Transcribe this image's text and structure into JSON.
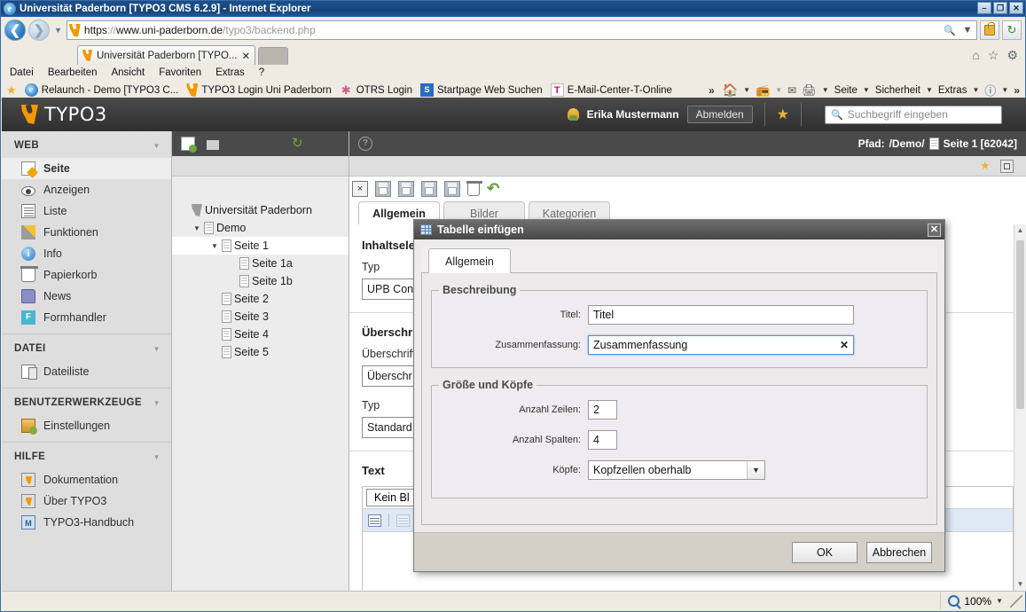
{
  "browser": {
    "window_title": "Universität Paderborn [TYPO3 CMS 6.2.9] - Internet Explorer",
    "minimize_label": "–",
    "maximize_label": "❐",
    "close_label": "✕",
    "url_scheme": "https",
    "url_sep": "://",
    "url_host": "www.uni-paderborn.de",
    "url_path": "/typo3/backend.php",
    "url_full": "https://www.uni-paderborn.de/typo3/backend.php",
    "tab_title": "Universität Paderborn [TYPO...",
    "tab_close": "✕",
    "menu": [
      "Datei",
      "Bearbeiten",
      "Ansicht",
      "Favoriten",
      "Extras",
      "?"
    ],
    "links": [
      {
        "label": "Relaunch - Demo [TYPO3 C...",
        "icon": "ie-icon"
      },
      {
        "label": "TYPO3 Login Uni Paderborn",
        "icon": "typo3-icon"
      },
      {
        "label": "OTRS Login",
        "icon": "otrs-icon"
      },
      {
        "label": "Startpage Web Suchen",
        "icon": "startpage-icon"
      },
      {
        "label": "E-Mail-Center-T-Online",
        "icon": "telekom-icon"
      }
    ],
    "command_bar": [
      "Seite",
      "Sicherheit",
      "Extras"
    ],
    "overflow": "»",
    "zoom_level": "100%"
  },
  "typo3": {
    "brand": "TYPO3",
    "user_name": "Erika Mustermann",
    "logout_label": "Abmelden",
    "search_placeholder": "Suchbegriff eingeben",
    "path_label": "Pfad:",
    "path_value": "/Demo/",
    "path_page": "Seite 1 [62042]",
    "modules": [
      {
        "group": "WEB",
        "items": [
          {
            "label": "Seite",
            "icon": "page-icon",
            "active": true
          },
          {
            "label": "Anzeigen",
            "icon": "eye-icon",
            "active": false
          },
          {
            "label": "Liste",
            "icon": "list-icon",
            "active": false
          },
          {
            "label": "Funktionen",
            "icon": "wand-icon",
            "active": false
          },
          {
            "label": "Info",
            "icon": "info-icon",
            "active": false
          },
          {
            "label": "Papierkorb",
            "icon": "trash-icon",
            "active": false
          },
          {
            "label": "News",
            "icon": "folder-icon",
            "active": false
          },
          {
            "label": "Formhandler",
            "icon": "form-icon",
            "active": false
          }
        ]
      },
      {
        "group": "DATEI",
        "items": [
          {
            "label": "Dateiliste",
            "icon": "filelist-icon",
            "active": false
          }
        ]
      },
      {
        "group": "BENUTZERWERKZEUGE",
        "items": [
          {
            "label": "Einstellungen",
            "icon": "settings-icon",
            "active": false
          }
        ]
      },
      {
        "group": "HILFE",
        "items": [
          {
            "label": "Dokumentation",
            "icon": "doc-icon",
            "active": false
          },
          {
            "label": "Über TYPO3",
            "icon": "doc-icon",
            "active": false
          },
          {
            "label": "TYPO3-Handbuch",
            "icon": "book-icon",
            "active": false
          }
        ]
      }
    ],
    "tree": [
      {
        "label": "Universität Paderborn",
        "level": 1,
        "toggle": "",
        "icon": "typo3-root-icon",
        "selected": false
      },
      {
        "label": "Demo",
        "level": 2,
        "toggle": "▼",
        "icon": "page-icon",
        "selected": false
      },
      {
        "label": "Seite 1",
        "level": 3,
        "toggle": "▼",
        "icon": "page-icon",
        "selected": true
      },
      {
        "label": "Seite 1a",
        "level": 4,
        "toggle": "",
        "icon": "page-icon",
        "selected": false
      },
      {
        "label": "Seite 1b",
        "level": 4,
        "toggle": "",
        "icon": "page-icon",
        "selected": false
      },
      {
        "label": "Seite 2",
        "level": 3,
        "toggle": "",
        "icon": "page-icon",
        "selected": false
      },
      {
        "label": "Seite 3",
        "level": 3,
        "toggle": "",
        "icon": "page-icon",
        "selected": false
      },
      {
        "label": "Seite 4",
        "level": 3,
        "toggle": "",
        "icon": "page-icon",
        "selected": false
      },
      {
        "label": "Seite 5",
        "level": 3,
        "toggle": "",
        "icon": "page-icon",
        "selected": false
      }
    ],
    "doc_tabs": [
      {
        "label": "Allgemein",
        "active": true
      },
      {
        "label": "Bilder",
        "active": false
      },
      {
        "label": "Kategorien",
        "active": false
      }
    ],
    "form": {
      "section1_title": "Inhaltselement",
      "typ_label": "Typ",
      "typ_value": "UPB Con",
      "section2_title": "Überschrift",
      "heading_label": "Überschrift",
      "heading_value": "Überschr",
      "typ2_label": "Typ",
      "typ2_value": "Standard",
      "section3_title": "Text",
      "rte_chip": "Kein Bl"
    }
  },
  "modal": {
    "title": "Tabelle einfügen",
    "close_label": "✕",
    "tab_label": "Allgemein",
    "group1_legend": "Beschreibung",
    "group2_legend": "Größe und Köpfe",
    "fields": {
      "title_label": "Titel:",
      "title_value": "Titel",
      "summary_label": "Zusammenfassung:",
      "summary_value": "Zusammenfassung",
      "summary_clear": "✕",
      "rows_label": "Anzahl Zeilen:",
      "rows_value": "2",
      "cols_label": "Anzahl Spalten:",
      "cols_value": "4",
      "heads_label": "Köpfe:",
      "heads_value": "Kopfzellen oberhalb",
      "heads_options": [
        "Kopfzellen oberhalb"
      ]
    },
    "ok_label": "OK",
    "cancel_label": "Abbrechen"
  },
  "colors": {
    "accent_orange": "#f49700",
    "title_blue": "#1c4f8a",
    "typo3_dark": "#3d3d3d",
    "focus_blue": "#4a90d9"
  }
}
